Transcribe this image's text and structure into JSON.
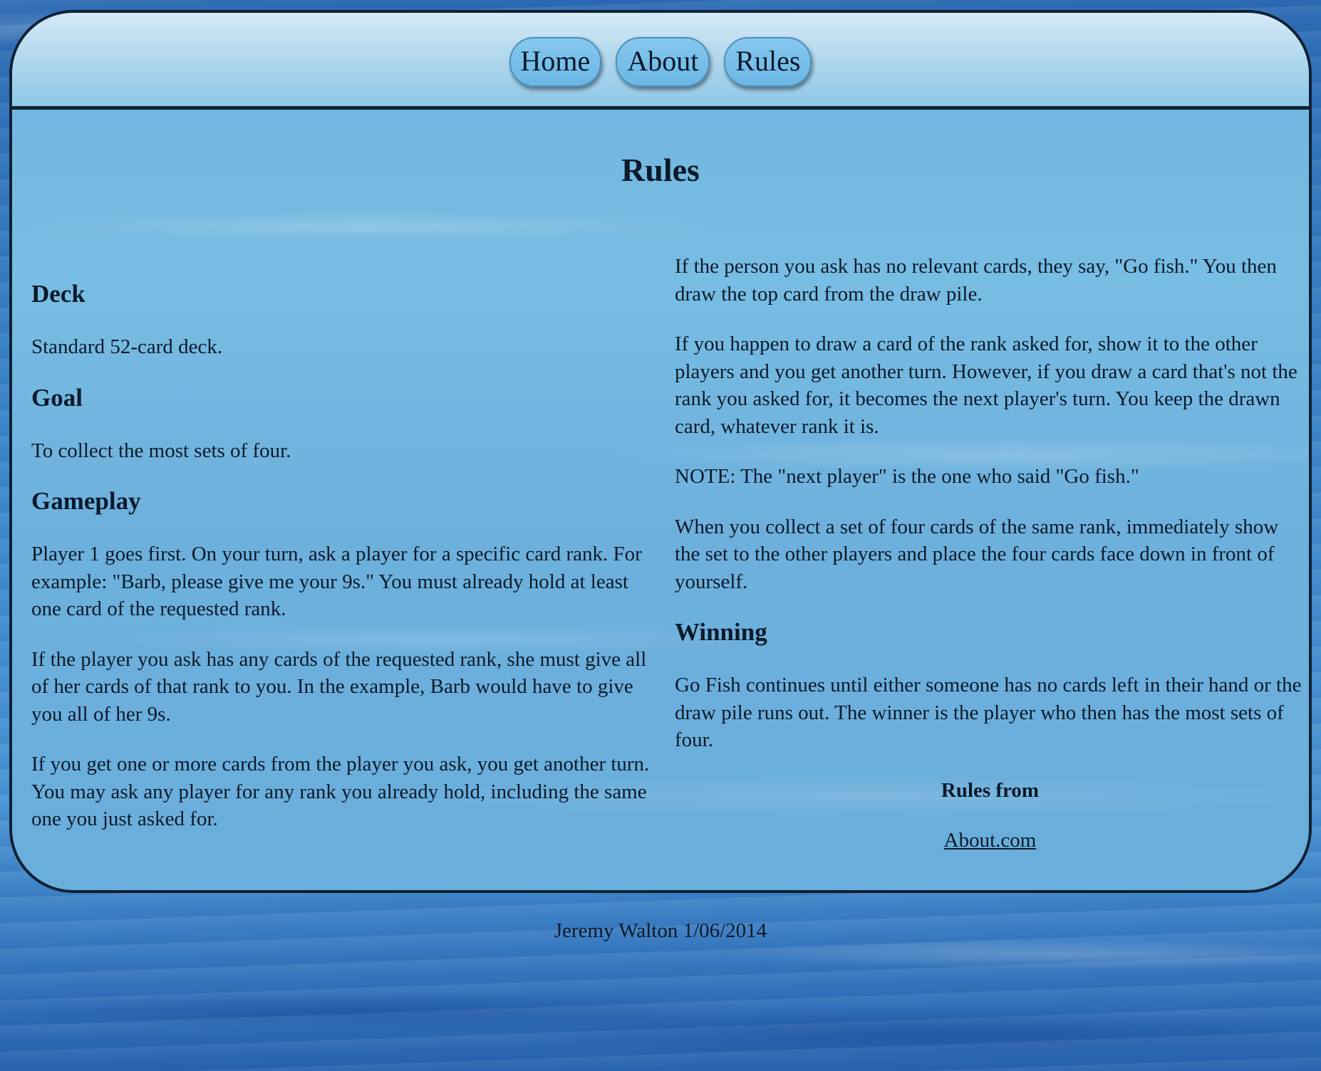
{
  "nav": {
    "items": [
      {
        "label": "Home"
      },
      {
        "label": "About"
      },
      {
        "label": "Rules"
      }
    ]
  },
  "page": {
    "title": "Rules"
  },
  "left": {
    "deck_heading": "Deck",
    "deck_text": "Standard 52-card deck.",
    "goal_heading": "Goal",
    "goal_text": "To collect the most sets of four.",
    "gameplay_heading": "Gameplay",
    "gameplay_p1": "Player 1 goes first. On your turn, ask a player for a specific card rank. For example: \"Barb, please give me your 9s.\" You must already hold at least one card of the requested rank.",
    "gameplay_p2": "If the player you ask has any cards of the requested rank, she must give all of her cards of that rank to you. In the example, Barb would have to give you all of her 9s.",
    "gameplay_p3": "If you get one or more cards from the player you ask, you get another turn. You may ask any player for any rank you already hold, including the same one you just asked for."
  },
  "right": {
    "p1": "If the person you ask has no relevant cards, they say, \"Go fish.\" You then draw the top card from the draw pile.",
    "p2": "If you happen to draw a card of the rank asked for, show it to the other players and you get another turn. However, if you draw a card that's not the rank you asked for, it becomes the next player's turn. You keep the drawn card, whatever rank it is.",
    "p3": "NOTE: The \"next player\" is the one who said \"Go fish.\"",
    "p4": "When you collect a set of four cards of the same rank, immediately show the set to the other players and place the four cards face down in front of yourself.",
    "winning_heading": "Winning",
    "winning_text": "Go Fish continues until either someone has no cards left in their hand or the draw pile runs out. The winner is the player who then has the most sets of four.",
    "credit_title": "Rules from",
    "credit_link": "About.com"
  },
  "footer": {
    "text": "Jeremy Walton 1/06/2014"
  }
}
